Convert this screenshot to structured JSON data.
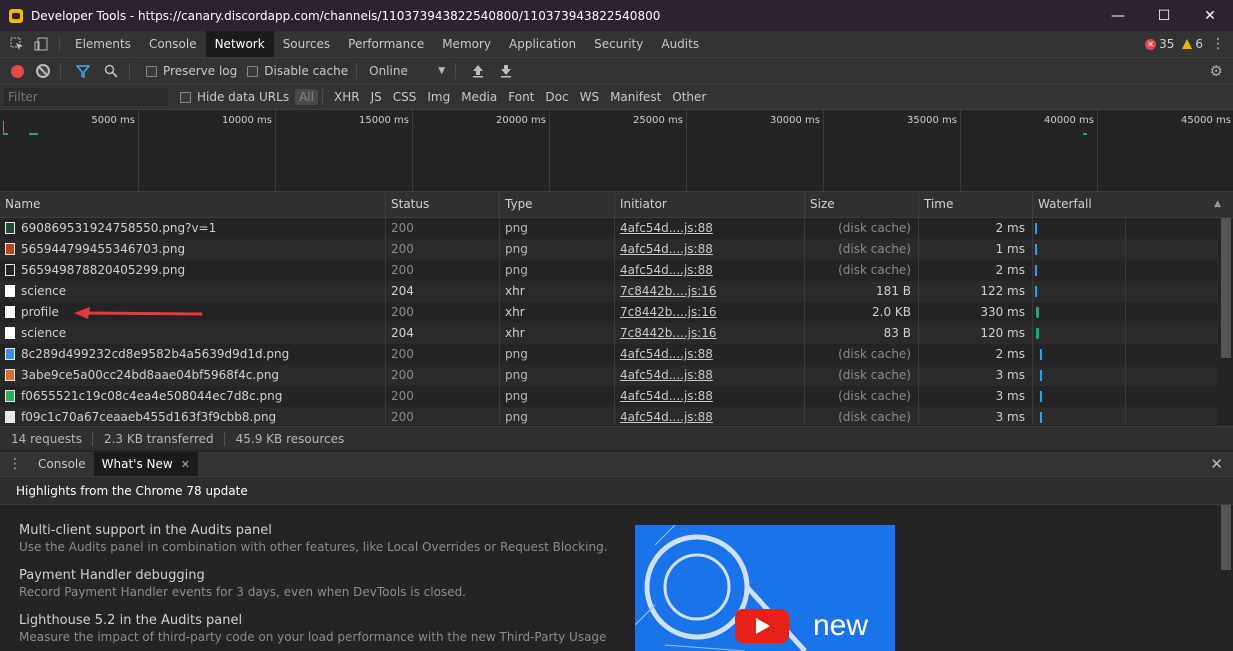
{
  "window": {
    "title": "Developer Tools - https://canary.discordapp.com/channels/110373943822540800/110373943822540800",
    "controls": [
      "—",
      "☐",
      "✕"
    ]
  },
  "tabs": [
    "Elements",
    "Console",
    "Network",
    "Sources",
    "Performance",
    "Memory",
    "Application",
    "Security",
    "Audits"
  ],
  "active_tab": "Network",
  "counts": {
    "errors": "35",
    "warnings": "6"
  },
  "toolbar": {
    "preserve_log": "Preserve log",
    "disable_cache": "Disable cache",
    "throttle": "Online"
  },
  "filter": {
    "placeholder": "Filter",
    "hide_data_urls": "Hide data URLs",
    "types": [
      "All",
      "XHR",
      "JS",
      "CSS",
      "Img",
      "Media",
      "Font",
      "Doc",
      "WS",
      "Manifest",
      "Other"
    ]
  },
  "overview": {
    "ticks": [
      "5000 ms",
      "10000 ms",
      "15000 ms",
      "20000 ms",
      "25000 ms",
      "30000 ms",
      "35000 ms",
      "40000 ms",
      "45000 ms"
    ]
  },
  "table": {
    "columns": [
      "Name",
      "Status",
      "Type",
      "Initiator",
      "Size",
      "Time",
      "Waterfall"
    ],
    "rows": [
      {
        "name": "690869531924758550.png?v=1",
        "status": "200",
        "type": "png",
        "initiator": "4afc54d....js:88",
        "size": "(disk cache)",
        "time": "2 ms",
        "icon": "#1f4b2f"
      },
      {
        "name": "565944799455346703.png",
        "status": "200",
        "type": "png",
        "initiator": "4afc54d....js:88",
        "size": "(disk cache)",
        "time": "1 ms",
        "icon": "#b8421f"
      },
      {
        "name": "565949878820405299.png",
        "status": "200",
        "type": "png",
        "initiator": "4afc54d....js:88",
        "size": "(disk cache)",
        "time": "2 ms",
        "icon": "#222222"
      },
      {
        "name": "science",
        "status": "204",
        "type": "xhr",
        "initiator": "7c8442b....js:16",
        "size": "181 B",
        "time": "122 ms",
        "icon": "#ffffff"
      },
      {
        "name": "profile",
        "status": "200",
        "type": "xhr",
        "initiator": "7c8442b....js:16",
        "size": "2.0 KB",
        "time": "330 ms",
        "icon": "#ffffff"
      },
      {
        "name": "science",
        "status": "204",
        "type": "xhr",
        "initiator": "7c8442b....js:16",
        "size": "83 B",
        "time": "120 ms",
        "icon": "#ffffff"
      },
      {
        "name": "8c289d499232cd8e9582b4a5639d9d1d.png",
        "status": "200",
        "type": "png",
        "initiator": "4afc54d....js:88",
        "size": "(disk cache)",
        "time": "2 ms",
        "icon": "#3a8ee6"
      },
      {
        "name": "3abe9ce5a00cc24bd8aae04bf5968f4c.png",
        "status": "200",
        "type": "png",
        "initiator": "4afc54d....js:88",
        "size": "(disk cache)",
        "time": "3 ms",
        "icon": "#e06a2a"
      },
      {
        "name": "f0655521c19c08c4ea4e508044ec7d8c.png",
        "status": "200",
        "type": "png",
        "initiator": "4afc54d....js:88",
        "size": "(disk cache)",
        "time": "3 ms",
        "icon": "#2fae5a"
      },
      {
        "name": "f09c1c70a67ceaaeb455d163f3f9cbb8.png",
        "status": "200",
        "type": "png",
        "initiator": "4afc54d....js:88",
        "size": "(disk cache)",
        "time": "3 ms",
        "icon": "#e8e8e8"
      }
    ]
  },
  "status": {
    "requests": "14 requests",
    "transferred": "2.3 KB transferred",
    "resources": "45.9 KB resources"
  },
  "drawer": {
    "tabs": [
      "Console",
      "What's New"
    ],
    "active_tab": "What's New",
    "headline": "Highlights from the Chrome 78 update",
    "items": [
      {
        "title": "Multi-client support in the Audits panel",
        "desc": "Use the Audits panel in combination with other features, like Local Overrides or Request Blocking."
      },
      {
        "title": "Payment Handler debugging",
        "desc": "Record Payment Handler events for 3 days, even when DevTools is closed."
      },
      {
        "title": "Lighthouse 5.2 in the Audits panel",
        "desc": "Measure the impact of third-party code on your load performance with the new Third-Party Usage"
      }
    ],
    "video_text": "new"
  },
  "colors": {
    "record": "#e34b4b",
    "waterfall_bar": "#2aa0e6",
    "thumbnail_bg": "#1a73e8"
  }
}
